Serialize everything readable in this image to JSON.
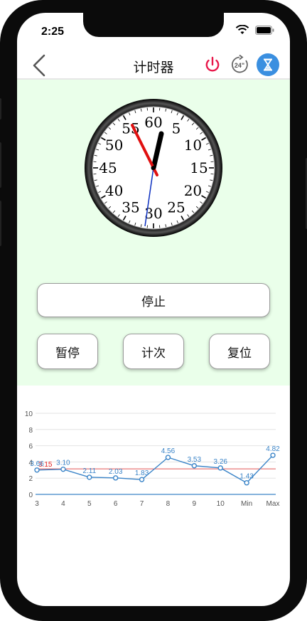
{
  "status": {
    "time": "2:25"
  },
  "nav": {
    "title": "计时器",
    "back_icon": "chevron-left-icon",
    "power_icon": "power-icon",
    "timer24_icon": "timer-24-icon",
    "timer24_label": "24\"",
    "hourglass_icon": "hourglass-icon",
    "power_color": "#e8174a",
    "accent_color": "#3a8fe0"
  },
  "clock": {
    "numbers": [
      "60",
      "5",
      "10",
      "15",
      "20",
      "25",
      "30",
      "35",
      "40",
      "45",
      "50",
      "55"
    ]
  },
  "buttons": {
    "stop": "停止",
    "pause": "暂停",
    "count": "计次",
    "reset": "复位"
  },
  "chart_data": {
    "type": "line",
    "categories": [
      "3",
      "4",
      "5",
      "6",
      "7",
      "8",
      "9",
      "10",
      "Min",
      "Max"
    ],
    "values": [
      3.0,
      3.1,
      2.11,
      2.03,
      1.83,
      4.56,
      3.53,
      3.26,
      1.43,
      4.82
    ],
    "data_labels": [
      "3.66",
      "3.10",
      "2.11",
      "2.03",
      "1.83",
      "4.56",
      "3.53",
      "3.26",
      "1.43",
      "4.82"
    ],
    "reference_line": {
      "value": 3.15,
      "label": "3.15",
      "color": "#e05555"
    },
    "ylim": [
      0,
      10
    ],
    "yticks": [
      "0",
      "2",
      "4",
      "6",
      "8",
      "10"
    ],
    "line_color": "#3a84c8",
    "grid": true
  }
}
